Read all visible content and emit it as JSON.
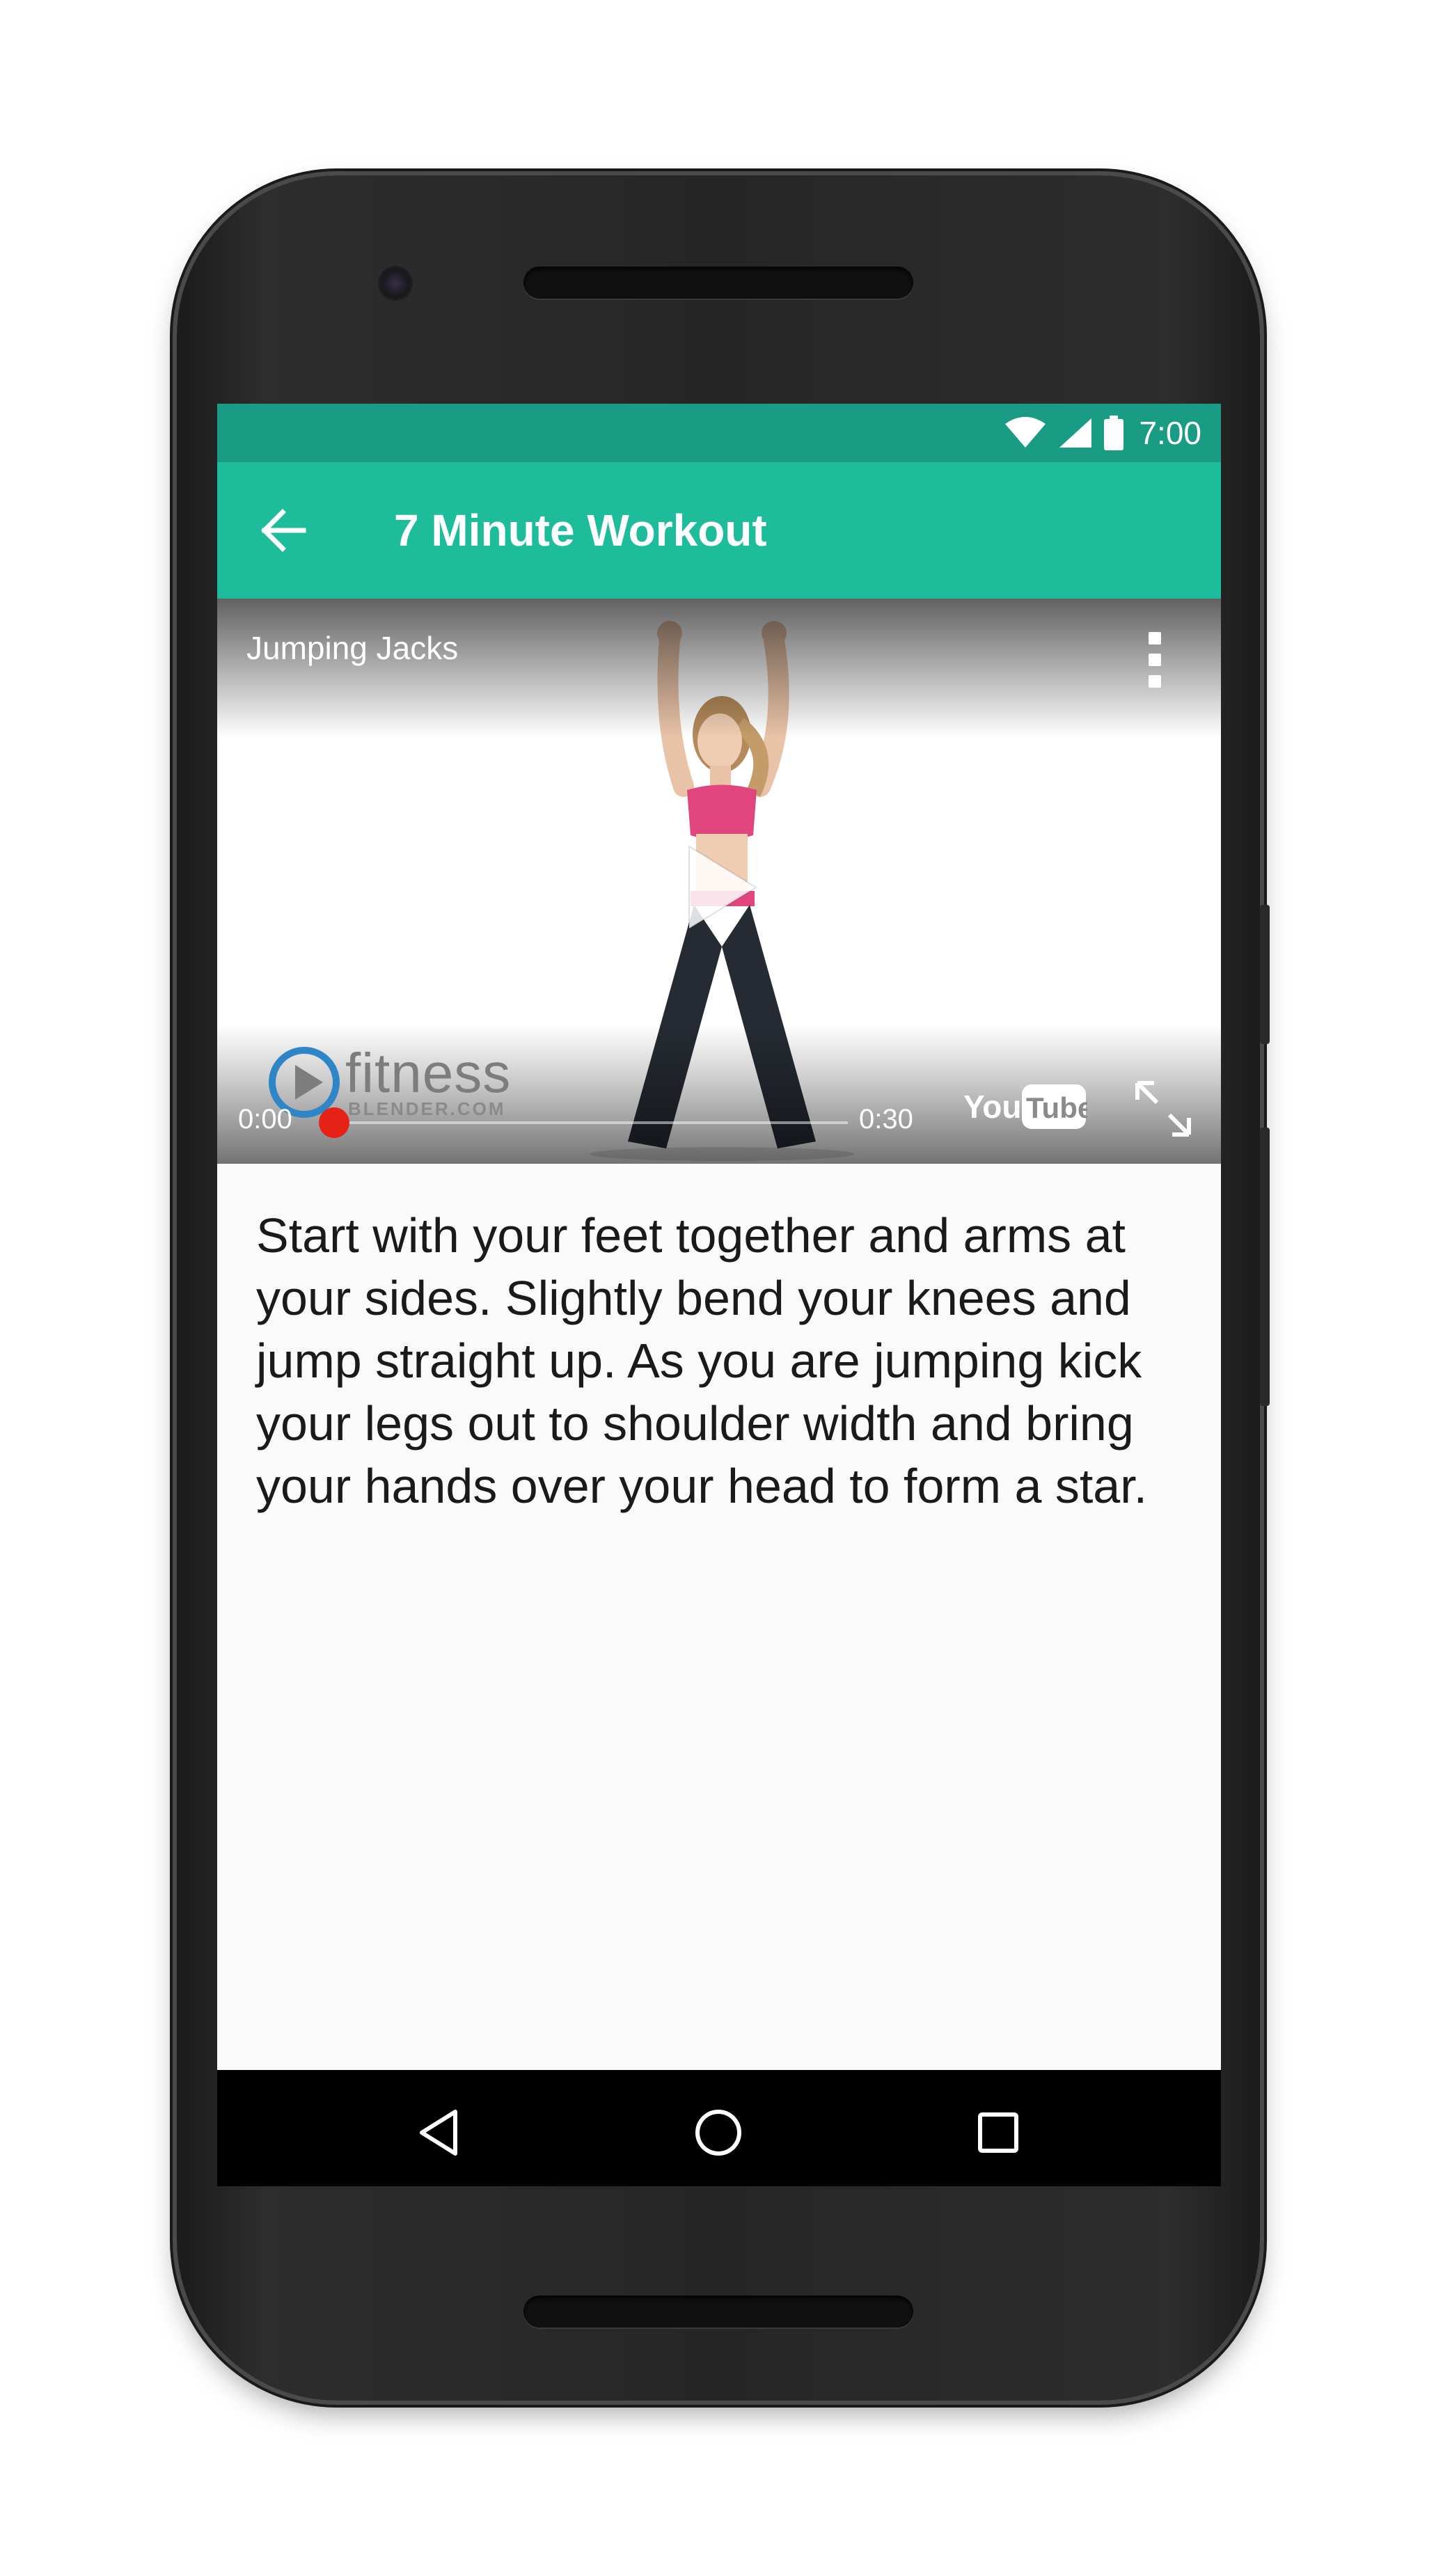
{
  "status_bar": {
    "time": "7:00",
    "icons": [
      "wifi-icon",
      "cellular-signal-icon",
      "battery-icon"
    ]
  },
  "app_bar": {
    "title": "7 Minute Workout",
    "back_icon": "arrow-back-icon"
  },
  "video": {
    "title": "Jumping Jacks",
    "current_time": "0:00",
    "total_time": "0:30",
    "progress": 0,
    "brand_word": "fitness",
    "brand_sub": "BLENDER.COM",
    "youtube_label": "YouTube",
    "icons": {
      "menu": "more-vert-icon",
      "play": "play-icon",
      "fullscreen": "fullscreen-icon"
    }
  },
  "exercise": {
    "description": "Start with your feet together and arms at your sides. Slightly bend your knees and jump straight up. As you are jumping kick your legs out to shoulder width and bring your hands over your head to form a star."
  },
  "nav_bar": {
    "icons": [
      "nav-back-icon",
      "nav-home-icon",
      "nav-recent-icon"
    ]
  },
  "colors": {
    "status_bar": "#1a9c84",
    "app_bar": "#1dbc9b",
    "progress": "#e62117",
    "screen_bg": "#fafafa",
    "nav_bar": "#000000"
  }
}
